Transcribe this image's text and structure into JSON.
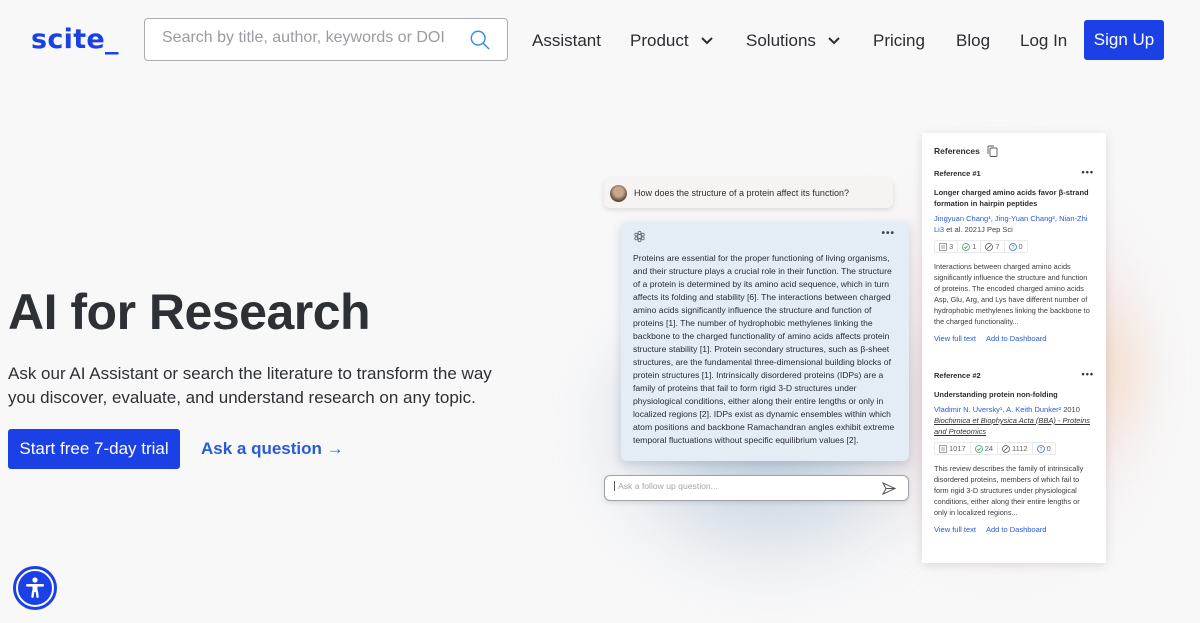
{
  "brand": {
    "logo": "scite_",
    "primary_color": "#1a40e6",
    "link_color": "#2a5bd7"
  },
  "nav": {
    "search_placeholder": "Search by title, author, keywords or DOI",
    "items": [
      {
        "label": "Assistant",
        "has_dropdown": false
      },
      {
        "label": "Product",
        "has_dropdown": true
      },
      {
        "label": "Solutions",
        "has_dropdown": true
      },
      {
        "label": "Pricing",
        "has_dropdown": false
      },
      {
        "label": "Blog",
        "has_dropdown": false
      },
      {
        "label": "Log In",
        "has_dropdown": false
      }
    ],
    "signup_label": "Sign Up"
  },
  "hero": {
    "title": "AI for Research",
    "subtitle": "Ask our AI Assistant or search the literature to transform the way you discover, evaluate, and understand research on any topic.",
    "cta_label": "Start free 7-day trial",
    "secondary_link": "Ask a question →"
  },
  "chat": {
    "question": "How does the structure of a protein affect its function?",
    "answer": "Proteins are essential for the proper functioning of living organisms, and their structure plays a crucial role in their function. The structure of a protein is determined by its amino acid sequence, which in turn affects its folding and stability [6]. The interactions between charged amino acids significantly influence the structure and function of proteins [1]. The number of hydrophobic methylenes linking the backbone to the charged functionality of amino acids affects protein structure stability [1]. Protein secondary structures, such as β-sheet structures, are the fundamental three-dimensional building blocks of protein structures [1]. Intrinsically disordered proteins (IDPs) are a family of proteins that fail to form rigid 3-D structures under physiological conditions, either along their entire lengths or only in localized regions [2]. IDPs exist as dynamic ensembles within which atom positions and backbone Ramachandran angles exhibit extreme temporal fluctuations without specific equilibrium values [2].",
    "more_label": "•••",
    "followup_placeholder": "Ask a follow up question..."
  },
  "references": {
    "heading": "References",
    "items": [
      {
        "label": "Reference #1",
        "title": "Longer charged amino acids favor β-strand formation in hairpin peptides",
        "authors": "Jingyuan Chang¹, Jing-Yuan Chang², Nian-Zhi Li3",
        "meta": " et al. 2021J Pep Sci",
        "journal": "",
        "metrics": {
          "publications": "3",
          "supporting": "1",
          "contrasting": "7",
          "mentioning": "0"
        },
        "abstract": "Interactions between charged amino acids significantly influence the structure and function of proteins. The encoded charged amino acids Asp, Glu, Arg, and Lys have different number of hydrophobic methylenes linking the backbone to the charged functionality...",
        "view_label": "View full text",
        "dashboard_label": "Add to Dashboard"
      },
      {
        "label": "Reference #2",
        "title": "Understanding protein non-folding",
        "authors": "Vladimir N. Uversky¹, A. Keith Dunker²",
        "meta": " 2010",
        "journal": "Biochimica et Biophysica Acta (BBA) - Proteins and Proteomics",
        "metrics": {
          "publications": "1017",
          "supporting": "24",
          "contrasting": "1112",
          "mentioning": "0"
        },
        "abstract": "This review describes the family of intrinsically disordered proteins, members of which fail to form rigid 3-D structures under physiological conditions, either along their entire lengths or only in localized regions...",
        "view_label": "View full text",
        "dashboard_label": "Add to Dashboard"
      }
    ]
  },
  "accessibility": {
    "icon": "accessibility-icon"
  }
}
